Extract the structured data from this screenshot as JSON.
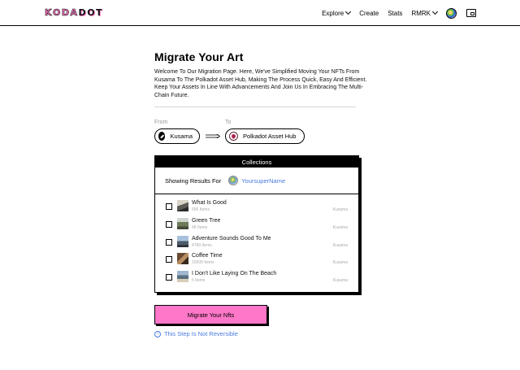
{
  "header": {
    "logo_letters": [
      "K",
      "O",
      "D",
      "A",
      "D",
      "O",
      "T"
    ],
    "nav": {
      "explore": "Explore",
      "create": "Create",
      "stats": "Stats",
      "chain": "RMRK"
    },
    "icons": [
      "chevron-down-icon",
      "avatar-icon",
      "wallet-icon"
    ]
  },
  "main": {
    "title": "Migrate Your Art",
    "intro": "Welcome To Our Migration Page. Here, We've Simplified Moving Your NFTs From Kusama To The Polkadot Asset Hub, Making The Process Quick, Easy And Efficient. Keep Your Assets In Line With Advancements And Join Us In Embracing The Multi-Chain Future.",
    "from_label": "From",
    "to_label": "To",
    "from_chain": "Kusama",
    "to_chain": "Polkadot Asset Hub"
  },
  "collections": {
    "header": "Collections",
    "showing_label": "Showing Results For",
    "username": "YoursuperName",
    "items": [
      {
        "name": "What Is Good",
        "count": "696 Items",
        "chain": "Kusama"
      },
      {
        "name": "Green Tree",
        "count": "68 Items",
        "chain": "Kusama"
      },
      {
        "name": "Adventure Sounds Good To Me",
        "count": "4789 Items",
        "chain": "Kusama"
      },
      {
        "name": "Coffee Time",
        "count": "10000 Items",
        "chain": "Kusama"
      },
      {
        "name": "I Don't Like Laying On The Beach",
        "count": "5 Items",
        "chain": "Kusama"
      }
    ]
  },
  "action": {
    "button_label": "Migrate Your Nfts",
    "warning": "This Step Is Not Reversible"
  },
  "colors": {
    "accent_pink": "#ff77c8",
    "link_blue": "#4a7be0",
    "border": "#000000"
  }
}
